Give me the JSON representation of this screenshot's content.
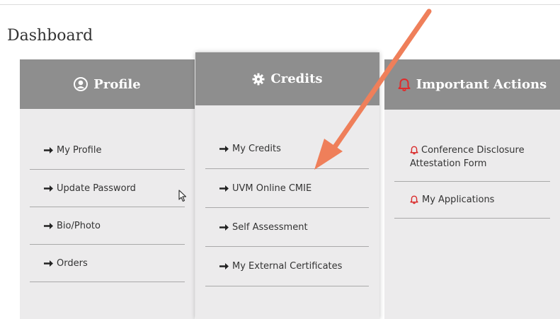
{
  "page": {
    "title": "Dashboard"
  },
  "profile": {
    "title": "Profile",
    "icon": "user-circle-icon",
    "items": [
      {
        "label": "My Profile"
      },
      {
        "label": "Update Password"
      },
      {
        "label": "Bio/Photo"
      },
      {
        "label": "Orders"
      }
    ]
  },
  "credits": {
    "title": "Credits",
    "icon": "gear-icon",
    "items": [
      {
        "label": "My Credits"
      },
      {
        "label": "UVM Online CMIE"
      },
      {
        "label": "Self Assessment"
      },
      {
        "label": "My External Certificates"
      }
    ]
  },
  "actions": {
    "title": "Important Actions",
    "icon": "bell-icon",
    "items": [
      {
        "label": "Conference Disclosure Attestation Form"
      },
      {
        "label": "My Applications"
      }
    ]
  },
  "colors": {
    "header_bg": "#8e8e8e",
    "card_bg": "#ecebec",
    "alert_red": "#d92b2b",
    "annotation_arrow": "#ef7f5a"
  }
}
